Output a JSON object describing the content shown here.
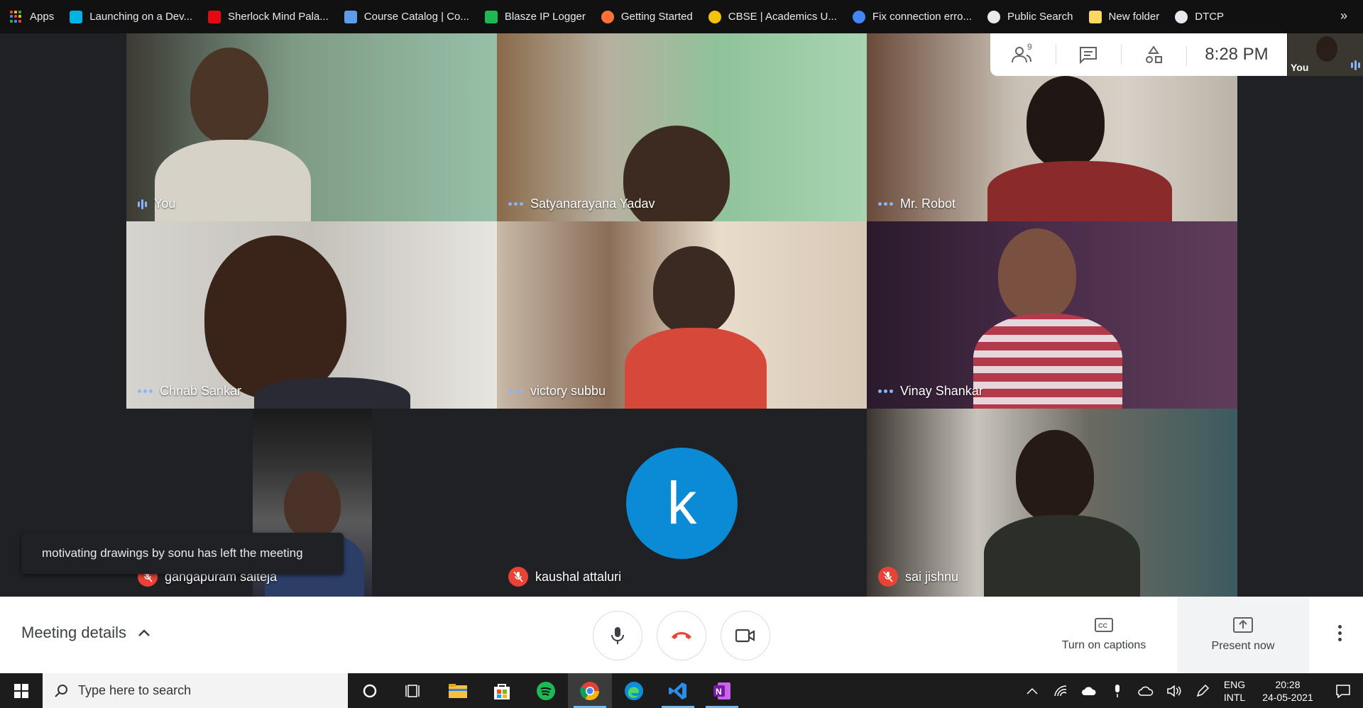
{
  "bookmarks": [
    {
      "label": "Apps",
      "icon": "apps-grid-icon",
      "color": "#e8eaed"
    },
    {
      "label": "Launching on a Dev...",
      "icon": "udacity-icon",
      "color": "#02b3e4"
    },
    {
      "label": "Sherlock Mind Pala...",
      "icon": "netflix-icon",
      "color": "#e50914"
    },
    {
      "label": "Course Catalog | Co...",
      "icon": "coursera-icon",
      "color": "#5d9cec"
    },
    {
      "label": "Blasze IP Logger",
      "icon": "blasze-icon",
      "color": "#1db954"
    },
    {
      "label": "Getting Started",
      "icon": "firefox-icon",
      "color": "#ff7139"
    },
    {
      "label": "CBSE | Academics U...",
      "icon": "cbse-icon",
      "color": "#f4c20d"
    },
    {
      "label": "Fix connection erro...",
      "icon": "google-icon",
      "color": "#4285f4"
    },
    {
      "label": "Public Search",
      "icon": "globe-icon",
      "color": "#e8eaed"
    },
    {
      "label": "New folder",
      "icon": "folder-icon",
      "color": "#fdd663"
    },
    {
      "label": "DTCP",
      "icon": "globe-icon",
      "color": "#e8eaed"
    }
  ],
  "bookmarks_more": "»",
  "top_controls": {
    "people_count": "9",
    "clock": "8:28 PM",
    "self_label": "You"
  },
  "tiles": [
    {
      "name": "You",
      "status": "speaking"
    },
    {
      "name": "Satyanarayana Yadav",
      "status": "active"
    },
    {
      "name": "Mr. Robot",
      "status": "active"
    },
    {
      "name": "Chnab Sankar",
      "status": "active"
    },
    {
      "name": "victory subbu",
      "status": "active"
    },
    {
      "name": "Vinay Shankar",
      "status": "active"
    },
    {
      "name": "gangapuram saiteja",
      "status": "muted"
    },
    {
      "name": "kaushal attaluri",
      "status": "muted",
      "avatar_letter": "k",
      "avatar_color": "#0b8ad6"
    },
    {
      "name": "sai jishnu",
      "status": "muted"
    }
  ],
  "toast": "motivating drawings by sonu has left the meeting",
  "bottom": {
    "meeting_details": "Meeting details",
    "captions": "Turn on captions",
    "present": "Present now"
  },
  "taskbar": {
    "search_placeholder": "Type here to search",
    "apps": [
      "cortana-icon",
      "task-view-icon",
      "file-explorer-icon",
      "store-icon",
      "spotify-icon",
      "chrome-icon",
      "edge-icon",
      "vscode-icon",
      "onenote-icon"
    ],
    "lang_top": "ENG",
    "lang_bottom": "INTL",
    "time": "20:28",
    "date": "24-05-2021"
  },
  "colors": {
    "accent_blue": "#8ab4f8",
    "end_call_red": "#ea4335",
    "meet_bg": "#202124"
  }
}
